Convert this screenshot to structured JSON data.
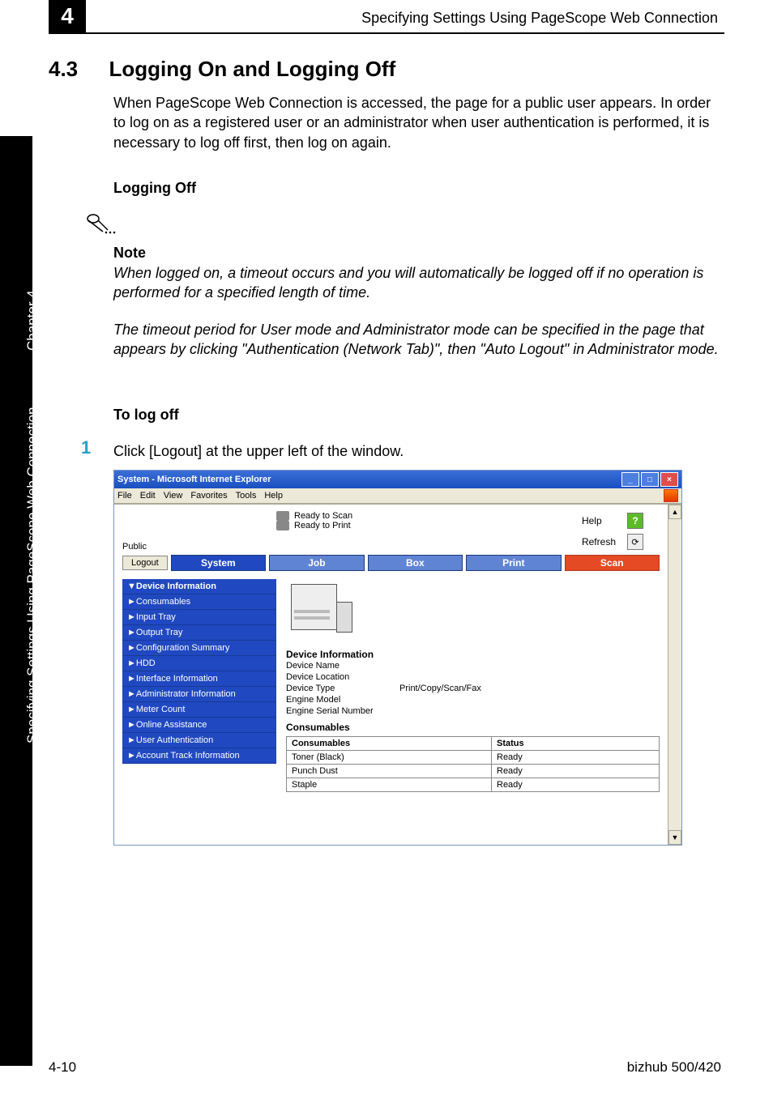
{
  "header": {
    "chapter_num": "4",
    "running_title": "Specifying Settings Using PageScope Web Connection"
  },
  "sidebar": {
    "top": "Chapter 4",
    "bottom": "Specifying Settings Using PageScope Web Connection"
  },
  "section": {
    "num": "4.3",
    "title": "Logging On and Logging Off",
    "intro": "When PageScope Web Connection is accessed, the page for a public user appears. In order to log on as a registered user or an administrator when user authentication is performed, it is necessary to log off first, then log on again.",
    "logging_off_label": "Logging Off",
    "note_label": "Note",
    "note_para1": "When logged on, a timeout occurs and you will automatically be logged off if no operation is performed for a specified length of time.",
    "note_para2": "The timeout period for User mode and Administrator mode can be specified in the page that appears by clicking \"Authentication (Network Tab)\", then \"Auto Logout\" in Administrator mode.",
    "to_log_off_label": "To log off",
    "step1_num": "1",
    "step1_text": "Click [Logout] at the upper left of the window."
  },
  "browser": {
    "title": "System - Microsoft Internet Explorer",
    "menus": [
      "File",
      "Edit",
      "View",
      "Favorites",
      "Tools",
      "Help"
    ],
    "status": {
      "scan": "Ready to Scan",
      "print": "Ready to Print"
    },
    "help_label": "Help",
    "refresh_label": "Refresh",
    "public_label": "Public",
    "logout_label": "Logout",
    "tabs": {
      "system": "System",
      "job": "Job",
      "box": "Box",
      "print": "Print",
      "scan": "Scan"
    },
    "nav": [
      "▼Device Information",
      "►Consumables",
      "►Input Tray",
      "►Output Tray",
      "►Configuration Summary",
      "►HDD",
      "►Interface Information",
      "►Administrator Information",
      "►Meter Count",
      "►Online Assistance",
      "►User Authentication",
      "►Account Track Information"
    ],
    "main": {
      "dev_info_title": "Device Information",
      "dev_name_label": "Device Name",
      "dev_loc_label": "Device Location",
      "dev_type_label": "Device Type",
      "dev_type_value": "Print/Copy/Scan/Fax",
      "engine_model_label": "Engine Model",
      "engine_serial_label": "Engine Serial Number",
      "consumables_title": "Consumables",
      "table": {
        "head1": "Consumables",
        "head2": "Status",
        "rows": [
          [
            "Toner (Black)",
            "Ready"
          ],
          [
            "Punch Dust",
            "Ready"
          ],
          [
            "Staple",
            "Ready"
          ]
        ]
      }
    }
  },
  "footer": {
    "left": "4-10",
    "right": "bizhub 500/420"
  }
}
